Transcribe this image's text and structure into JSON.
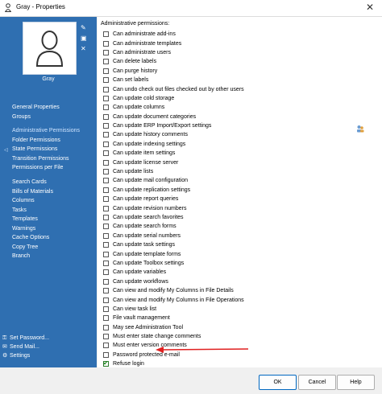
{
  "window": {
    "title": "Gray - Properties",
    "close_glyph": "✕"
  },
  "user": {
    "name": "Gray"
  },
  "sidebar": {
    "group1": [
      "General Properties",
      "Groups"
    ],
    "group2": [
      "Administrative Permissions",
      "Folder Permissions",
      "State Permissions",
      "Transition Permissions",
      "Permissions per File"
    ],
    "group3": [
      "Search Cards",
      "Bills of Materials",
      "Columns",
      "Tasks",
      "Templates",
      "Warnings",
      "Cache Options",
      "Copy Tree",
      "Branch"
    ],
    "bottom": [
      "Set Password...",
      "Send Mail...",
      "Settings"
    ],
    "active_item": "Administrative Permissions"
  },
  "permissions": {
    "label": "Administrative permissions:",
    "items": [
      {
        "label": "Can administrate add-ins",
        "checked": false
      },
      {
        "label": "Can administrate templates",
        "checked": false
      },
      {
        "label": "Can administrate users",
        "checked": false
      },
      {
        "label": "Can delete labels",
        "checked": false
      },
      {
        "label": "Can purge history",
        "checked": false
      },
      {
        "label": "Can set labels",
        "checked": false
      },
      {
        "label": "Can undo check out files checked out by other users",
        "checked": false
      },
      {
        "label": "Can update cold storage",
        "checked": false
      },
      {
        "label": "Can update columns",
        "checked": false
      },
      {
        "label": "Can update document categories",
        "checked": false
      },
      {
        "label": "Can update ERP Import/Export settings",
        "checked": false
      },
      {
        "label": "Can update history comments",
        "checked": false
      },
      {
        "label": "Can update indexing settings",
        "checked": false
      },
      {
        "label": "Can update item settings",
        "checked": false
      },
      {
        "label": "Can update license server",
        "checked": false
      },
      {
        "label": "Can update lists",
        "checked": false
      },
      {
        "label": "Can update mail configuration",
        "checked": false
      },
      {
        "label": "Can update replication settings",
        "checked": false
      },
      {
        "label": "Can update report queries",
        "checked": false
      },
      {
        "label": "Can update revision numbers",
        "checked": false
      },
      {
        "label": "Can update search favorites",
        "checked": false
      },
      {
        "label": "Can update search forms",
        "checked": false
      },
      {
        "label": "Can update serial numbers",
        "checked": false
      },
      {
        "label": "Can update task settings",
        "checked": false
      },
      {
        "label": "Can update template forms",
        "checked": false
      },
      {
        "label": "Can update Toolbox settings",
        "checked": false
      },
      {
        "label": "Can update variables",
        "checked": false
      },
      {
        "label": "Can update workflows",
        "checked": false
      },
      {
        "label": "Can view and modify My Columns in File Details",
        "checked": false
      },
      {
        "label": "Can view and modify My Columns in File Operations",
        "checked": false
      },
      {
        "label": "Can view task list",
        "checked": false
      },
      {
        "label": "File vault management",
        "checked": false
      },
      {
        "label": "May see Administration Tool",
        "checked": false
      },
      {
        "label": "Must enter state change comments",
        "checked": false
      },
      {
        "label": "Must enter version comments",
        "checked": false
      },
      {
        "label": "Password protected e-mail",
        "checked": false
      },
      {
        "label": "Refuse login",
        "checked": true
      }
    ]
  },
  "buttons": {
    "ok": "OK",
    "cancel": "Cancel",
    "help": "Help"
  },
  "colors": {
    "sidebar": "#2f6fb1",
    "annotation_arrow": "#e02020"
  }
}
